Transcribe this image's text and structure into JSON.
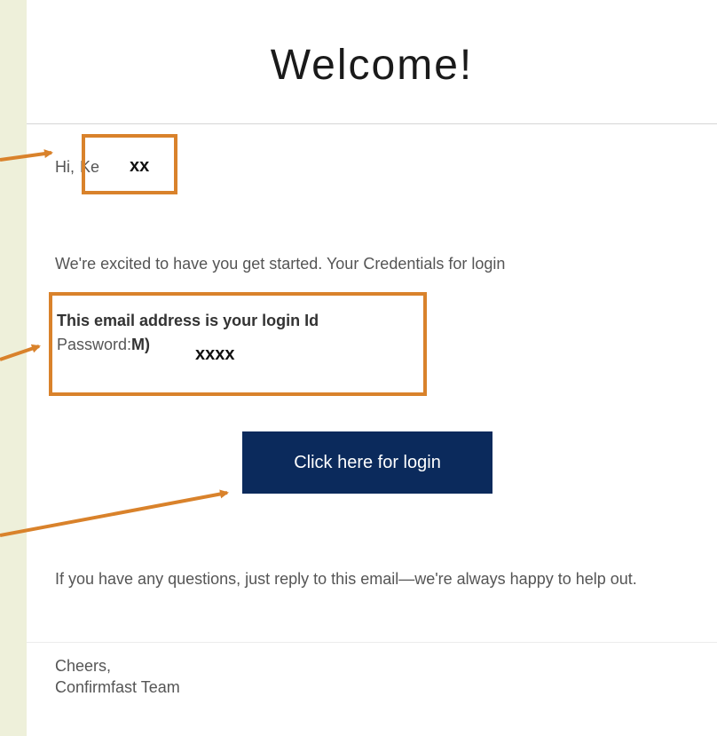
{
  "email": {
    "title": "Welcome!",
    "greeting_prefix": "Hi,",
    "greeting_name": "Ke",
    "intro": "We're excited to have you get started. Your Credentials for login",
    "login_id_text": "This email address is your login Id",
    "password_label": "Password:",
    "password_visible": "M)",
    "login_button": "Click here for login",
    "questions": "If you have any questions, just reply to this email—we're always happy to help out.",
    "signoff": "Cheers,",
    "team": "Confirmfast Team"
  },
  "annotations": {
    "name_redaction": "xx",
    "password_redaction": "xxxx",
    "highlight_color": "#d9822b"
  },
  "colors": {
    "background": "#eef0da",
    "button": "#0b2a5c",
    "body_text": "#555555"
  }
}
